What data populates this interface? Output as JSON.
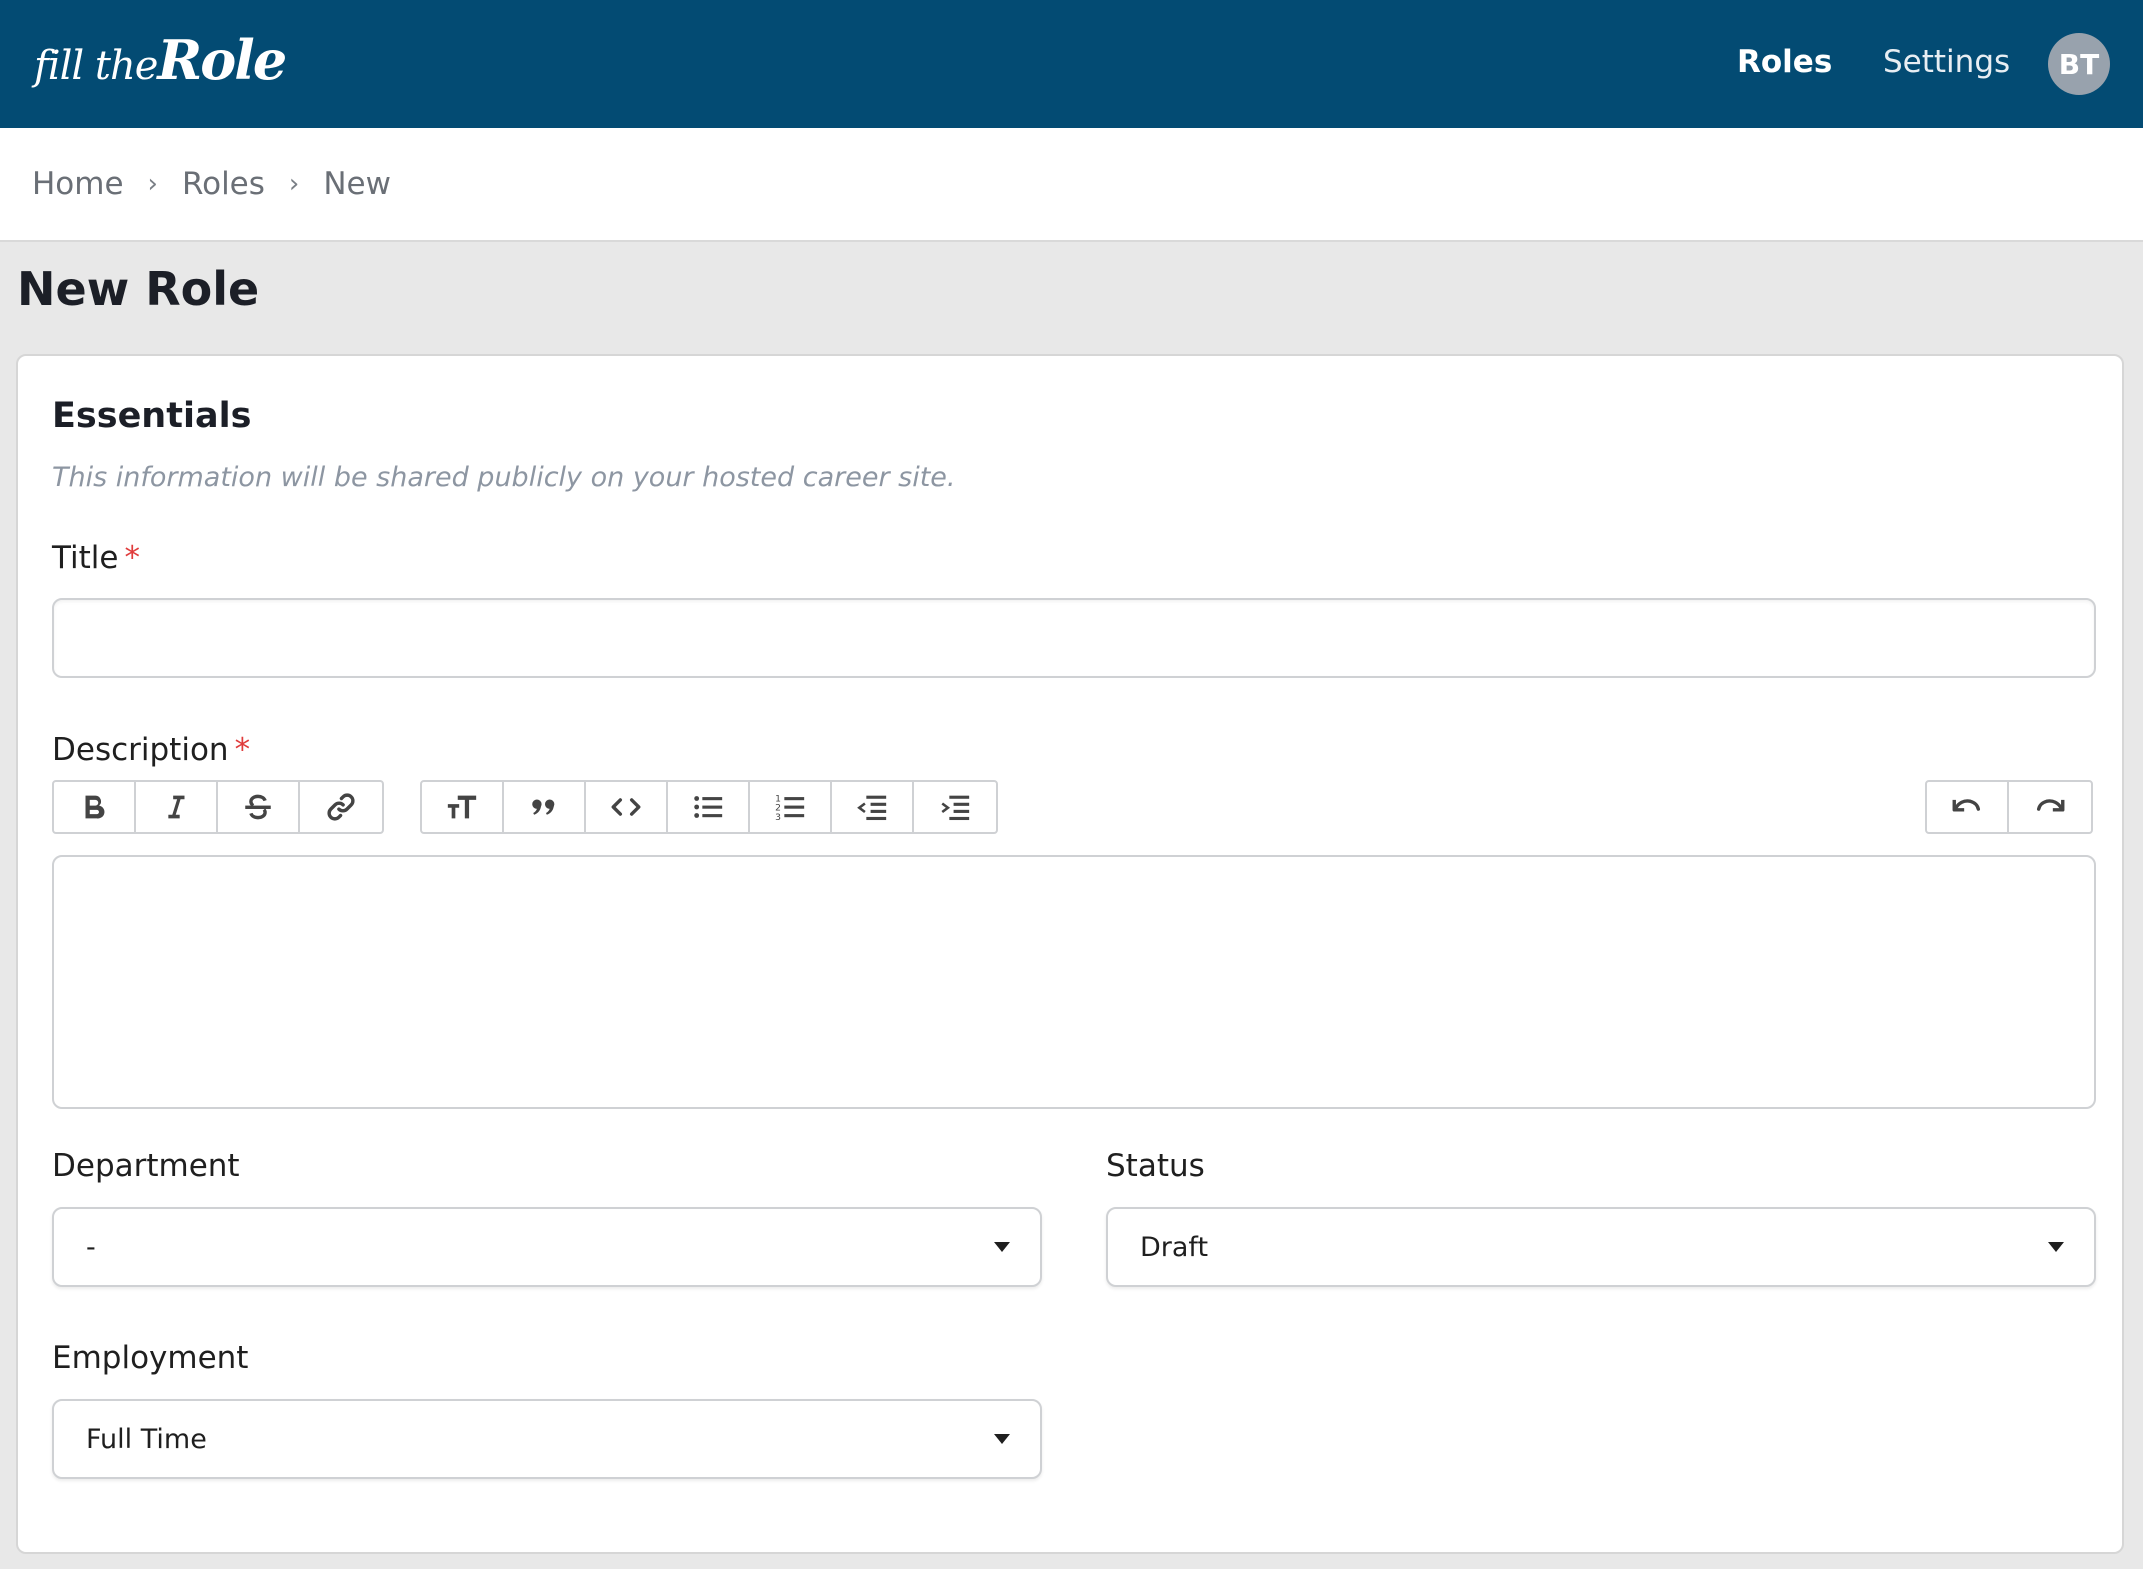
{
  "header": {
    "logo_small": "fill the",
    "logo_big": "Role",
    "nav": [
      {
        "label": "Roles",
        "active": true
      },
      {
        "label": "Settings",
        "active": false
      }
    ],
    "avatar_initials": "BT",
    "bg_color": "#034b73"
  },
  "breadcrumb": [
    "Home",
    "Roles",
    "New"
  ],
  "page_title": "New Role",
  "essentials": {
    "title": "Essentials",
    "subtitle": "This information will be shared publicly on your hosted career site."
  },
  "fields": {
    "title": {
      "label": "Title",
      "required_mark": "*",
      "value": ""
    },
    "description": {
      "label": "Description",
      "required_mark": "*",
      "value": ""
    },
    "department": {
      "label": "Department",
      "value": "-"
    },
    "status": {
      "label": "Status",
      "value": "Draft"
    },
    "employment": {
      "label": "Employment",
      "value": "Full Time"
    }
  },
  "toolbar": {
    "text_group": [
      "bold-icon",
      "italic-icon",
      "strikethrough-icon",
      "link-icon"
    ],
    "block_group": [
      "heading-icon",
      "quote-icon",
      "code-icon",
      "bullet-list-icon",
      "numbered-list-icon",
      "outdent-icon",
      "indent-icon"
    ],
    "history_group": [
      "undo-icon",
      "redo-icon"
    ]
  }
}
